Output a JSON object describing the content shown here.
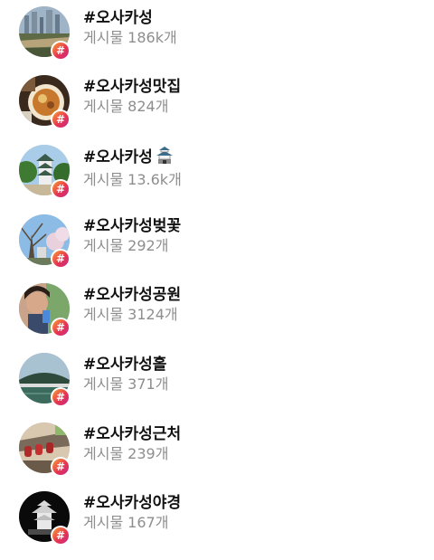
{
  "hashtags": [
    {
      "tag": "#오사카성",
      "label": "게시물",
      "count": "186k개",
      "thumb": "city-skyline",
      "colors": [
        "#8aa3b8",
        "#5a6a4a",
        "#b0a27a"
      ]
    },
    {
      "tag": "#오사카성맛집",
      "label": "게시물",
      "count": "824개",
      "thumb": "food-bowl",
      "colors": [
        "#3a2a1a",
        "#c97a2a",
        "#e8c87a"
      ]
    },
    {
      "tag": "#오사카성",
      "emoji": "castle-emoji",
      "label": "게시물",
      "count": "13.6k개",
      "thumb": "castle-trees",
      "colors": [
        "#9ec6e8",
        "#2f6a2a",
        "#e8e8e8"
      ]
    },
    {
      "tag": "#오사카성벚꽃",
      "label": "게시물",
      "count": "292개",
      "thumb": "cherry-blossom",
      "colors": [
        "#8fbde8",
        "#5a4a3a",
        "#e8d4e0"
      ]
    },
    {
      "tag": "#오사카성공원",
      "label": "게시물",
      "count": "3124개",
      "thumb": "person-selfie",
      "colors": [
        "#d8a88a",
        "#3a2a22",
        "#7aa86a"
      ]
    },
    {
      "tag": "#오사카성홀",
      "label": "게시물",
      "count": "371개",
      "thumb": "arena-river",
      "colors": [
        "#a8c0d0",
        "#2a4a3a",
        "#3a6a5a"
      ]
    },
    {
      "tag": "#오사카성근처",
      "label": "게시물",
      "count": "239개",
      "thumb": "red-lanterns",
      "colors": [
        "#d8c8b0",
        "#a82a2a",
        "#6a5a4a"
      ]
    },
    {
      "tag": "#오사카성야경",
      "label": "게시물",
      "count": "167개",
      "thumb": "castle-night",
      "colors": [
        "#0a0a0a",
        "#f0f0f0",
        "#5a5a5a"
      ]
    }
  ],
  "badge_symbol": "#"
}
